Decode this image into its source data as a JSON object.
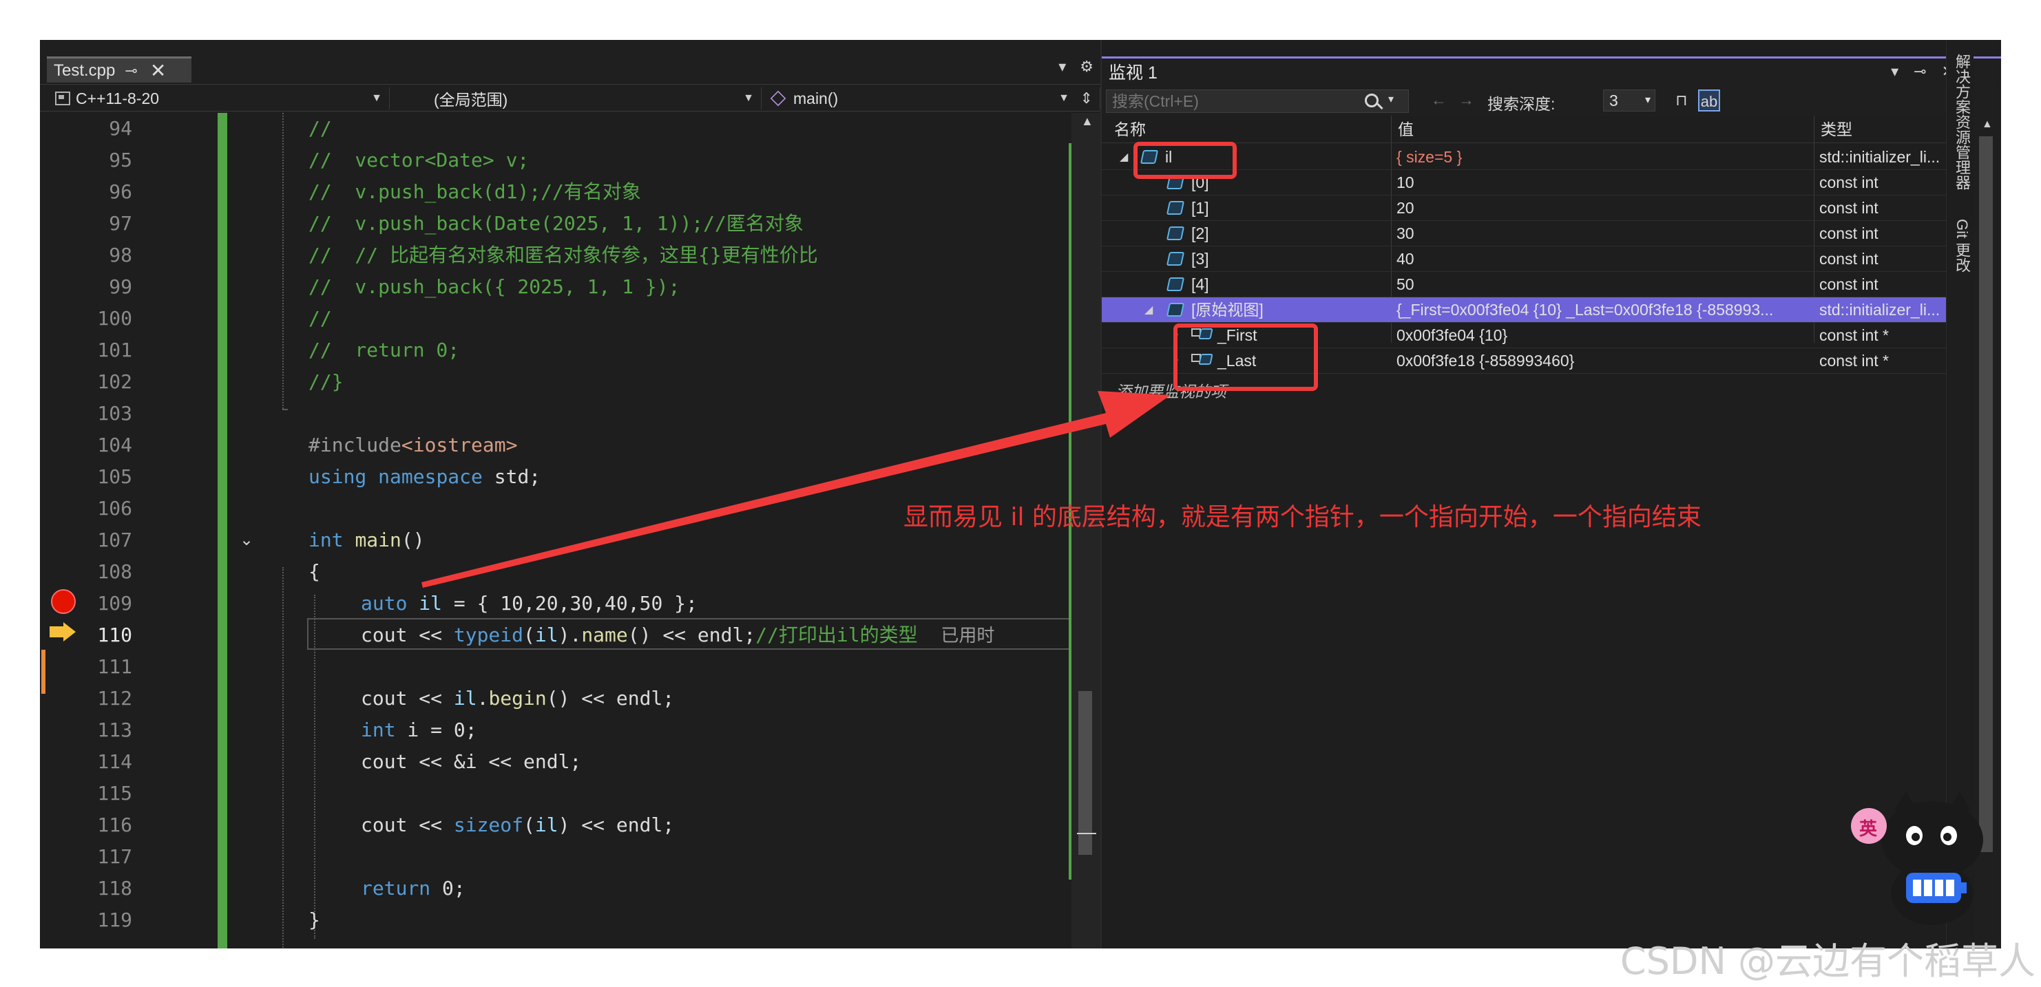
{
  "editor": {
    "tab_label": "Test.cpp",
    "tab_pin": "⊸",
    "tab_close": "✕",
    "tabbar_dropdown": "▾",
    "tabbar_gear": "⚙",
    "nav_project": "C++11-8-20",
    "nav_scope": "(全局范围)",
    "nav_function": "main()",
    "nav_split": "⇕",
    "hint_text": "已用时",
    "lines": [
      {
        "n": "94"
      },
      {
        "n": "95"
      },
      {
        "n": "96"
      },
      {
        "n": "97"
      },
      {
        "n": "98"
      },
      {
        "n": "99"
      },
      {
        "n": "100"
      },
      {
        "n": "101"
      },
      {
        "n": "102"
      },
      {
        "n": "103"
      },
      {
        "n": "104"
      },
      {
        "n": "105"
      },
      {
        "n": "106"
      },
      {
        "n": "107"
      },
      {
        "n": "108"
      },
      {
        "n": "109"
      },
      {
        "n": "110"
      },
      {
        "n": "111"
      },
      {
        "n": "112"
      },
      {
        "n": "113"
      },
      {
        "n": "114"
      },
      {
        "n": "115"
      },
      {
        "n": "116"
      },
      {
        "n": "117"
      },
      {
        "n": "118"
      },
      {
        "n": "119"
      }
    ],
    "code": {
      "l94": "//",
      "l95": "//  vector<Date> v;",
      "l96": "//  v.push_back(d1);//有名对象",
      "l97": "//  v.push_back(Date(2025, 1, 1));//匿名对象",
      "l98": "//  // 比起有名对象和匿名对象传参，这里{}更有性价比",
      "l99": "//  v.push_back({ 2025, 1, 1 });",
      "l100": "//",
      "l101": "//  return 0;",
      "l102": "//}",
      "l104_a": "#include",
      "l104_b": "<iostream>",
      "l105_a": "using",
      "l105_b": "namespace",
      "l105_c": " std;",
      "l107_a": "int",
      "l107_b": "main",
      "l107_c": "()",
      "l108": "{",
      "l109_a": "auto",
      "l109_b": "il",
      "l109_c": " = { 10,20,30,40,50 };",
      "l110_a": "cout << ",
      "l110_b": "typeid",
      "l110_c": "(",
      "l110_d": "il",
      "l110_e": ").",
      "l110_f": "name",
      "l110_g": "() << endl;",
      "l110_h": "//打印出il的类型",
      "l112_a": "cout << ",
      "l112_b": "il",
      "l112_c": ".",
      "l112_d": "begin",
      "l112_e": "() << endl;",
      "l113_a": "int",
      "l113_b": " i = 0;",
      "l114": "cout << &i << endl;",
      "l116_a": "cout << ",
      "l116_b": "sizeof",
      "l116_c": "(",
      "l116_d": "il",
      "l116_e": ") << endl;",
      "l118_a": "return",
      "l118_b": " 0;",
      "l119": "}"
    }
  },
  "watch": {
    "title": "监视 1",
    "title_controls": [
      "▾",
      "⊸",
      "✕"
    ],
    "search_placeholder": "搜索(Ctrl+E)",
    "search_dropdown": "▾",
    "nav_back": "←",
    "nav_forward": "→",
    "depth_label": "搜索深度:",
    "depth_value": "3",
    "depth_dropdown": "▾",
    "columns": {
      "name": "名称",
      "value": "值",
      "type": "类型"
    },
    "rows": [
      {
        "name": "il",
        "value": "{ size=5 }",
        "type": "std::initializer_li..."
      },
      {
        "name": "[0]",
        "value": "10",
        "type": "const int"
      },
      {
        "name": "[1]",
        "value": "20",
        "type": "const int"
      },
      {
        "name": "[2]",
        "value": "30",
        "type": "const int"
      },
      {
        "name": "[3]",
        "value": "40",
        "type": "const int"
      },
      {
        "name": "[4]",
        "value": "50",
        "type": "const int"
      },
      {
        "name": "[原始视图]",
        "value": "{_First=0x00f3fe04 {10} _Last=0x00f3fe18 {-858993...",
        "type": "std::initializer_li..."
      },
      {
        "name": "_First",
        "value": "0x00f3fe04 {10}",
        "type": "const int *"
      },
      {
        "name": "_Last",
        "value": "0x00f3fe18 {-858993460}",
        "type": "const int *"
      }
    ],
    "add_item": "添加要监视的项"
  },
  "side_tabs": [
    "解决方案资源管理器",
    "Git 更改"
  ],
  "annotation": {
    "text": "显而易见 il 的底层结构，就是有两个指针，一个指向开始，一个指向结束",
    "color": "#ee3535"
  },
  "mascot": {
    "badge": "英"
  },
  "watermark": "CSDN @云边有个稻草人"
}
